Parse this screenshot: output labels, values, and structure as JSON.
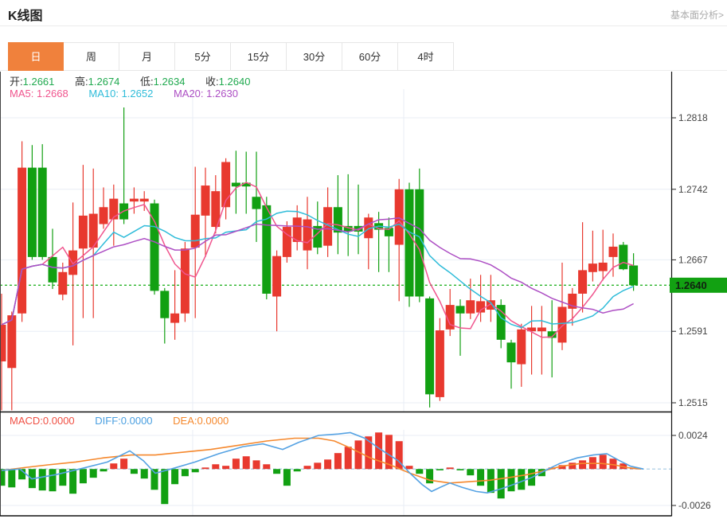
{
  "header": {
    "title": "K线图",
    "link": "基本面分析>"
  },
  "tabs": {
    "items": [
      "日",
      "周",
      "月",
      "5分",
      "15分",
      "30分",
      "60分",
      "4时"
    ],
    "active_index": 0
  },
  "quote": {
    "open_label": "开:",
    "open_value": "1.2661",
    "high_label": "高:",
    "high_value": "1.2674",
    "low_label": "低:",
    "low_value": "1.2634",
    "close_label": "收:",
    "close_value": "1.2640"
  },
  "ma_legend": {
    "ma5_label": "MA5:",
    "ma5_value": "1.2668",
    "ma10_label": "MA10:",
    "ma10_value": "1.2652",
    "ma20_label": "MA20:",
    "ma20_value": "1.2630"
  },
  "macd_legend": {
    "macd": "MACD:0.0000",
    "diff": "DIFF:0.0000",
    "dea": "DEA:0.0000"
  },
  "colors": {
    "up": "#e8392f",
    "down": "#12a012",
    "tab_active": "#f0813c",
    "current_line": "#2ab42a",
    "price_tag_bg": "#12a112",
    "price_tag_text": "#112211",
    "ma5": "#f0558e",
    "ma10": "#2fbcd9",
    "ma20": "#ad4fc4",
    "diff": "#55a2e3",
    "dea": "#f5882d",
    "macd_zero": "#b9d5ea",
    "grid": "#e8eef5",
    "axis_line": "#222222",
    "axis_text": "#444444",
    "quote_green": "#1fa94e"
  },
  "chart_data": {
    "type": "candlestick+macd",
    "main": {
      "y_axis": [
        1.2818,
        1.2742,
        1.2667,
        1.2591,
        1.2515
      ],
      "current_price": 1.264,
      "current_price_label": "1.2640",
      "ma_periods": [
        5,
        10,
        20
      ],
      "candles": [
        [
          2,
          1.2559,
          1.2631,
          1.2507,
          1.2598
        ],
        [
          14.8,
          1.2552,
          1.2612,
          1.2507,
          1.2608
        ],
        [
          27.6,
          1.261,
          1.2793,
          1.2601,
          1.2765
        ],
        [
          40.4,
          1.2765,
          1.2789,
          1.2667,
          1.267
        ],
        [
          53.2,
          1.2765,
          1.279,
          1.2667,
          1.267
        ],
        [
          66,
          1.267,
          1.27,
          1.2636,
          1.2643
        ],
        [
          78.8,
          1.263,
          1.2664,
          1.2624,
          1.2654
        ],
        [
          91.6,
          1.2651,
          1.2728,
          1.2576,
          1.2677
        ],
        [
          104.4,
          1.2679,
          1.2768,
          1.2605,
          1.2714
        ],
        [
          117.2,
          1.268,
          1.2764,
          1.2605,
          1.2716
        ],
        [
          130,
          1.2705,
          1.2744,
          1.27,
          1.2723
        ],
        [
          142.8,
          1.271,
          1.2747,
          1.2682,
          1.2732
        ],
        [
          155.6,
          1.2727,
          1.2829,
          1.2705,
          1.271
        ],
        [
          168.4,
          1.2729,
          1.2744,
          1.2716,
          1.2732
        ],
        [
          181.2,
          1.2729,
          1.274,
          1.2719,
          1.2732
        ],
        [
          194,
          1.2727,
          1.2731,
          1.263,
          1.2634
        ],
        [
          206.8,
          1.2634,
          1.2637,
          1.2578,
          1.2605
        ],
        [
          219.6,
          1.26,
          1.2656,
          1.2582,
          1.261
        ],
        [
          232.4,
          1.261,
          1.2686,
          1.2601,
          1.2679
        ],
        [
          245.2,
          1.268,
          1.2766,
          1.2605,
          1.2715
        ],
        [
          258,
          1.2714,
          1.2765,
          1.267,
          1.2746
        ],
        [
          270.8,
          1.2702,
          1.2757,
          1.2695,
          1.274
        ],
        [
          283.6,
          1.2723,
          1.2775,
          1.271,
          1.2771
        ],
        [
          296.4,
          1.2749,
          1.2783,
          1.2716,
          1.2745
        ],
        [
          309.2,
          1.2749,
          1.2782,
          1.2716,
          1.2745
        ],
        [
          322,
          1.2734,
          1.2782,
          1.2686,
          1.2721
        ],
        [
          334.8,
          1.2725,
          1.2734,
          1.2625,
          1.2631
        ],
        [
          347.6,
          1.2628,
          1.2677,
          1.2591,
          1.2671
        ],
        [
          360.4,
          1.267,
          1.2708,
          1.2664,
          1.2702
        ],
        [
          373.2,
          1.2686,
          1.2725,
          1.2677,
          1.2712
        ],
        [
          386,
          1.2677,
          1.2734,
          1.2657,
          1.271
        ],
        [
          398.8,
          1.2703,
          1.2729,
          1.2673,
          1.268
        ],
        [
          411.6,
          1.2682,
          1.2744,
          1.267,
          1.2723
        ],
        [
          424.4,
          1.2723,
          1.2757,
          1.2673,
          1.2696
        ],
        [
          437.2,
          1.2703,
          1.2758,
          1.2671,
          1.2697
        ],
        [
          450,
          1.2703,
          1.2747,
          1.2673,
          1.2697
        ],
        [
          462.8,
          1.269,
          1.2716,
          1.2657,
          1.2712
        ],
        [
          475.6,
          1.2706,
          1.2718,
          1.2654,
          1.2699
        ],
        [
          488.4,
          1.2701,
          1.2712,
          1.2654,
          1.2692
        ],
        [
          501.2,
          1.2683,
          1.2753,
          1.2623,
          1.2742
        ],
        [
          514,
          1.2742,
          1.2749,
          1.2617,
          1.2628
        ],
        [
          526.8,
          1.2742,
          1.2764,
          1.2622,
          1.2628
        ],
        [
          539.6,
          1.2626,
          1.2628,
          1.251,
          1.2524
        ],
        [
          552.4,
          1.2521,
          1.2605,
          1.2517,
          1.2592
        ],
        [
          565.2,
          1.2593,
          1.2636,
          1.2586,
          1.2619
        ],
        [
          578,
          1.2618,
          1.2625,
          1.2565,
          1.261
        ],
        [
          590.8,
          1.261,
          1.2647,
          1.2604,
          1.2624
        ],
        [
          603.6,
          1.2611,
          1.2651,
          1.2601,
          1.2623
        ],
        [
          616.4,
          1.2614,
          1.2651,
          1.2601,
          1.2624
        ],
        [
          629.2,
          1.2619,
          1.2625,
          1.2573,
          1.2582
        ],
        [
          642,
          1.2579,
          1.2582,
          1.253,
          1.2558
        ],
        [
          654.8,
          1.2556,
          1.2599,
          1.2532,
          1.2593
        ],
        [
          667.6,
          1.2591,
          1.2618,
          1.2545,
          1.2595
        ],
        [
          680.4,
          1.2591,
          1.2618,
          1.2545,
          1.2595
        ],
        [
          693.2,
          1.2591,
          1.2624,
          1.2542,
          1.2584
        ],
        [
          706,
          1.2579,
          1.2664,
          1.2571,
          1.2617
        ],
        [
          718.8,
          1.2615,
          1.2637,
          1.2597,
          1.2631
        ],
        [
          731.6,
          1.2631,
          1.2707,
          1.2611,
          1.2656
        ],
        [
          744.4,
          1.2654,
          1.2698,
          1.2644,
          1.2663
        ],
        [
          757.2,
          1.2655,
          1.2699,
          1.2645,
          1.2664
        ],
        [
          770,
          1.267,
          1.2695,
          1.2649,
          1.2681
        ],
        [
          782.8,
          1.2683,
          1.2686,
          1.2656,
          1.2657
        ],
        [
          795.6,
          1.2661,
          1.2674,
          1.2634,
          1.264
        ]
      ]
    },
    "macd": {
      "y_axis": [
        0.0024,
        -0.0026
      ],
      "histogram": [
        -0.00119,
        -0.00131,
        -0.00074,
        -0.00136,
        -0.00153,
        -0.00159,
        -0.00119,
        -0.00176,
        -0.00102,
        -0.00062,
        -0.00017,
        0.0004,
        0.00074,
        -0.00034,
        -0.00068,
        -0.00148,
        -0.0025,
        -0.00108,
        -0.00051,
        -0.00023,
        0.00011,
        0.00034,
        0.00023,
        0.00074,
        0.00091,
        0.00062,
        0.00034,
        -0.00034,
        -0.00119,
        -0.00017,
        0.00023,
        0.00045,
        0.00068,
        0.00114,
        0.00159,
        0.00204,
        0.00233,
        0.00261,
        0.00244,
        0.00199,
        0.00023,
        -0.00034,
        -0.00102,
        -6e-05,
        0.00011,
        -6e-05,
        -0.00045,
        -0.00119,
        -0.0017,
        -0.0021,
        -0.00159,
        -0.00148,
        -0.00119,
        -0.00051,
        0.00011,
        0.00028,
        0.00045,
        0.00062,
        0.00085,
        0.00102,
        0.00074,
        0.0004,
        6e-05
      ],
      "diff_points": [
        [
          2,
          -0.0001
        ],
        [
          25,
          0
        ],
        [
          40,
          -0.0007
        ],
        [
          70,
          -0.0004
        ],
        [
          100,
          0
        ],
        [
          135,
          0.0005
        ],
        [
          163,
          0.0013
        ],
        [
          180,
          0.0006
        ],
        [
          195,
          -0.0003
        ],
        [
          215,
          0
        ],
        [
          245,
          0.0005
        ],
        [
          275,
          0.0011
        ],
        [
          305,
          0.0016
        ],
        [
          330,
          0.0018
        ],
        [
          355,
          0.0014
        ],
        [
          375,
          0.0019
        ],
        [
          400,
          0.0024
        ],
        [
          425,
          0.0025
        ],
        [
          440,
          0.0026
        ],
        [
          458,
          0.0022
        ],
        [
          478,
          0.0014
        ],
        [
          500,
          0.0006
        ],
        [
          515,
          -0.0003
        ],
        [
          530,
          -0.0011
        ],
        [
          542,
          -0.0016
        ],
        [
          553,
          -0.0013
        ],
        [
          565,
          -0.001
        ],
        [
          580,
          -0.0013
        ],
        [
          598,
          -0.0016
        ],
        [
          612,
          -0.0017
        ],
        [
          630,
          -0.0014
        ],
        [
          650,
          -0.001
        ],
        [
          668,
          -0.0006
        ],
        [
          685,
          -0.0001
        ],
        [
          703,
          0.0004
        ],
        [
          725,
          0.0008
        ],
        [
          745,
          0.001
        ],
        [
          762,
          0.0011
        ],
        [
          778,
          0.0006
        ],
        [
          792,
          0.0002
        ],
        [
          808,
          0
        ]
      ],
      "dea_points": [
        [
          2,
          -0.0001
        ],
        [
          30,
          0.0001
        ],
        [
          60,
          0.0003
        ],
        [
          95,
          0.0005
        ],
        [
          130,
          0.0008
        ],
        [
          165,
          0.001
        ],
        [
          195,
          0.001
        ],
        [
          230,
          0.0012
        ],
        [
          265,
          0.0014
        ],
        [
          300,
          0.0017
        ],
        [
          335,
          0.002
        ],
        [
          370,
          0.0022
        ],
        [
          400,
          0.0022
        ],
        [
          420,
          0.002
        ],
        [
          440,
          0.0015
        ],
        [
          465,
          0.0008
        ],
        [
          490,
          0.0003
        ],
        [
          515,
          -0.0003
        ],
        [
          540,
          -0.0008
        ],
        [
          565,
          -0.001
        ],
        [
          590,
          -0.0009
        ],
        [
          615,
          -0.0008
        ],
        [
          640,
          -0.0006
        ],
        [
          662,
          -0.0004
        ],
        [
          685,
          -0.0001
        ],
        [
          705,
          0.0002
        ],
        [
          730,
          0.0004
        ],
        [
          755,
          0.0004
        ],
        [
          772,
          0.0003
        ],
        [
          788,
          0.0001
        ],
        [
          805,
          0
        ]
      ]
    }
  }
}
